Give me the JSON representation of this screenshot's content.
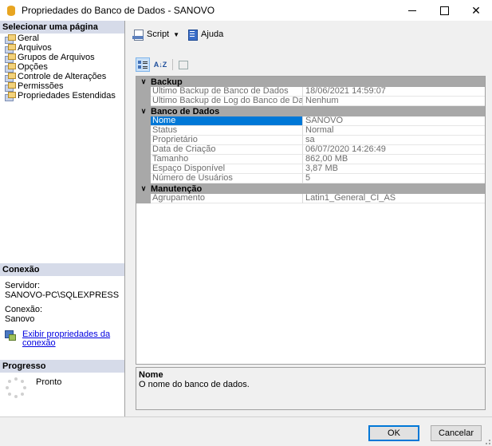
{
  "window": {
    "title": "Propriedades do Banco de Dados - SANOVO",
    "close_glyph": "✕"
  },
  "left": {
    "select_page_header": "Selecionar uma página",
    "pages": [
      {
        "label": "Geral"
      },
      {
        "label": "Arquivos"
      },
      {
        "label": "Grupos de Arquivos"
      },
      {
        "label": "Opções"
      },
      {
        "label": "Controle de Alterações"
      },
      {
        "label": "Permissões"
      },
      {
        "label": "Propriedades Estendidas"
      }
    ],
    "connection_header": "Conexão",
    "server_label": "Servidor:",
    "server_value": "SANOVO-PC\\SQLEXPRESS",
    "connection_label": "Conexão:",
    "connection_value": "Sanovo",
    "view_props_link_1": "Exibir propriedades da",
    "view_props_link_2": "conexão",
    "progress_header": "Progresso",
    "progress_status": "Pronto"
  },
  "toolbar": {
    "script_label": "Script",
    "help_label": "Ajuda"
  },
  "grid_toolbar": {
    "sort_alpha_glyph": "A↓Z"
  },
  "propgrid": {
    "categories": [
      {
        "name": "Backup",
        "toggle": "∨",
        "rows": [
          {
            "name": "Último Backup de Banco de Dados",
            "value": "18/06/2021 14:59:07"
          },
          {
            "name": "Último Backup de Log do Banco de Dados",
            "value": "Nenhum"
          }
        ]
      },
      {
        "name": "Banco de Dados",
        "toggle": "∨",
        "rows": [
          {
            "name": "Nome",
            "value": "SANOVO"
          },
          {
            "name": "Status",
            "value": "Normal"
          },
          {
            "name": "Proprietário",
            "value": "sa"
          },
          {
            "name": "Data de Criação",
            "value": "06/07/2020 14:26:49"
          },
          {
            "name": "Tamanho",
            "value": "862,00 MB"
          },
          {
            "name": "Espaço Disponível",
            "value": "3,87 MB"
          },
          {
            "name": "Número de Usuários",
            "value": "5"
          }
        ]
      },
      {
        "name": "Manutenção",
        "toggle": "∨",
        "rows": [
          {
            "name": "Agrupamento",
            "value": "Latin1_General_CI_AS"
          }
        ]
      }
    ]
  },
  "description": {
    "title": "Nome",
    "text": "O nome do banco de dados."
  },
  "buttons": {
    "ok": "OK",
    "cancel": "Cancelar"
  }
}
